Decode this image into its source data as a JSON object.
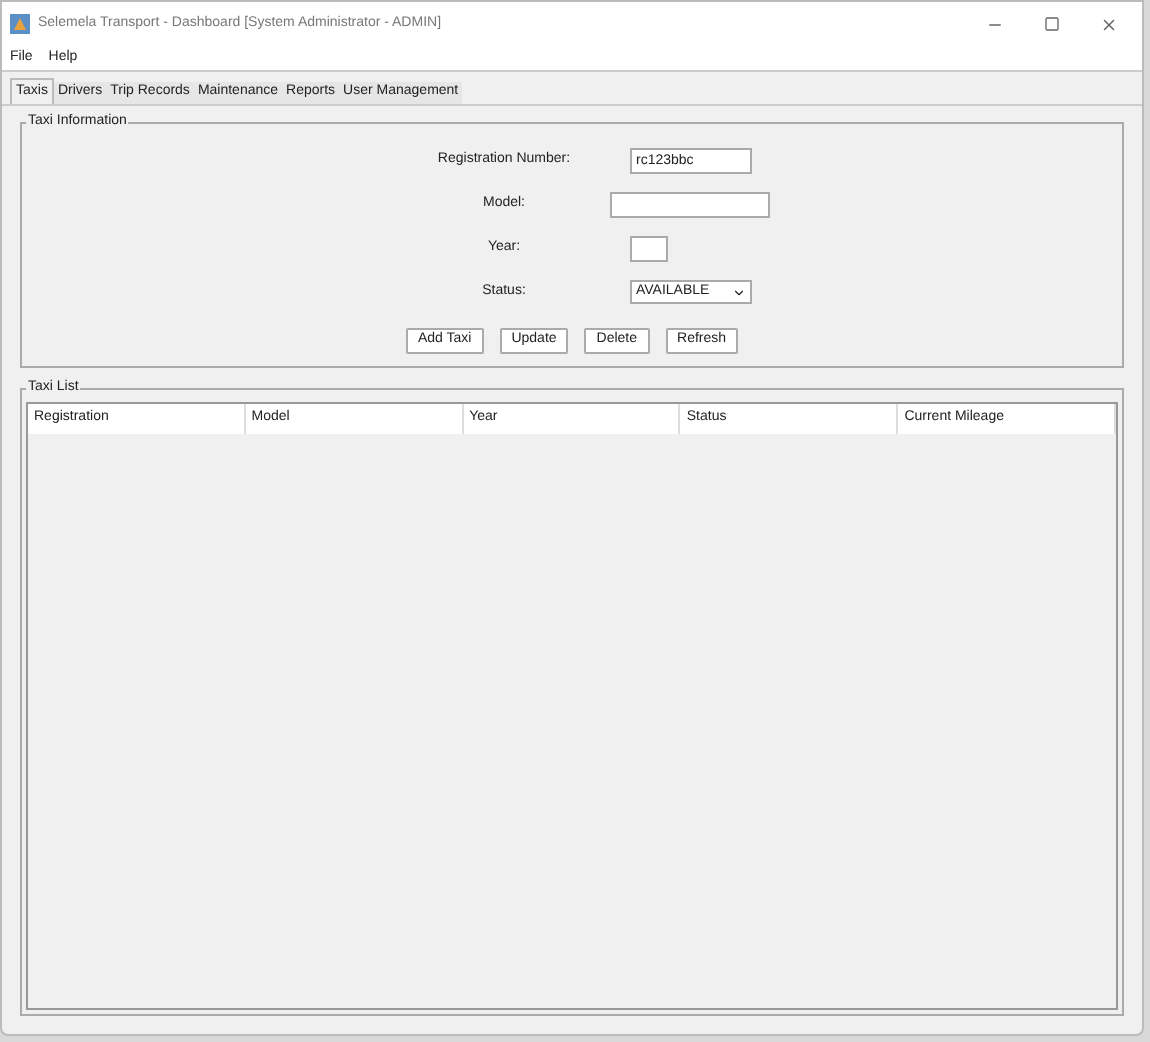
{
  "window": {
    "title": "Selemela Transport - Dashboard [System Administrator - ADMIN]"
  },
  "menu": [
    "File",
    "Help"
  ],
  "tabs": [
    {
      "label": "Taxis",
      "selected": true
    },
    {
      "label": "Drivers",
      "selected": false
    },
    {
      "label": "Trip Records",
      "selected": false
    },
    {
      "label": "Maintenance",
      "selected": false
    },
    {
      "label": "Reports",
      "selected": false
    },
    {
      "label": "User Management",
      "selected": false
    }
  ],
  "taxi_information": {
    "title": "Taxi Information",
    "fields": [
      {
        "kind": "text",
        "label": "Registration Number:",
        "value": "rc123bbc"
      },
      {
        "kind": "text",
        "label": "Model:"
      },
      {
        "kind": "text",
        "label": "Year:"
      },
      {
        "kind": "select",
        "label": "Status:",
        "value": "AVAILABLE"
      }
    ],
    "buttons": [
      "Add Taxi",
      "Update",
      "Delete",
      "Refresh"
    ]
  },
  "taxi_list": {
    "title": "Taxi List",
    "columns": [
      "Registration",
      "Model",
      "Year",
      "Status",
      "Current Mileage"
    ]
  }
}
